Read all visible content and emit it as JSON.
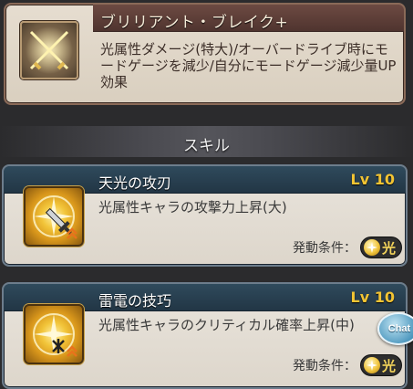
{
  "ability": {
    "title": "ブリリアント・ブレイク+",
    "description": "光属性ダメージ(特大)/オーバードライブ時にモードゲージを減少/自分にモードゲージ減少量UP効果"
  },
  "section": {
    "label": "スキル"
  },
  "skills": [
    {
      "name": "天光の攻刃",
      "level": "Lv 10",
      "description": "光属性キャラの攻撃力上昇(大)",
      "condition_label": "発動条件：",
      "element": "光",
      "icon": "sword-arrow-icon"
    },
    {
      "name": "雷電の技巧",
      "level": "Lv 10",
      "description": "光属性キャラのクリティカル確率上昇(中)",
      "condition_label": "発動条件：",
      "element": "光",
      "icon": "sparkle-arrow-icon"
    }
  ],
  "chat": {
    "label": "Chat"
  },
  "colors": {
    "element_light": "#f0c43c",
    "level_text": "#f3c433",
    "skill_title_band": "#2f4a5c",
    "ability_title_band": "#6d4a42"
  }
}
